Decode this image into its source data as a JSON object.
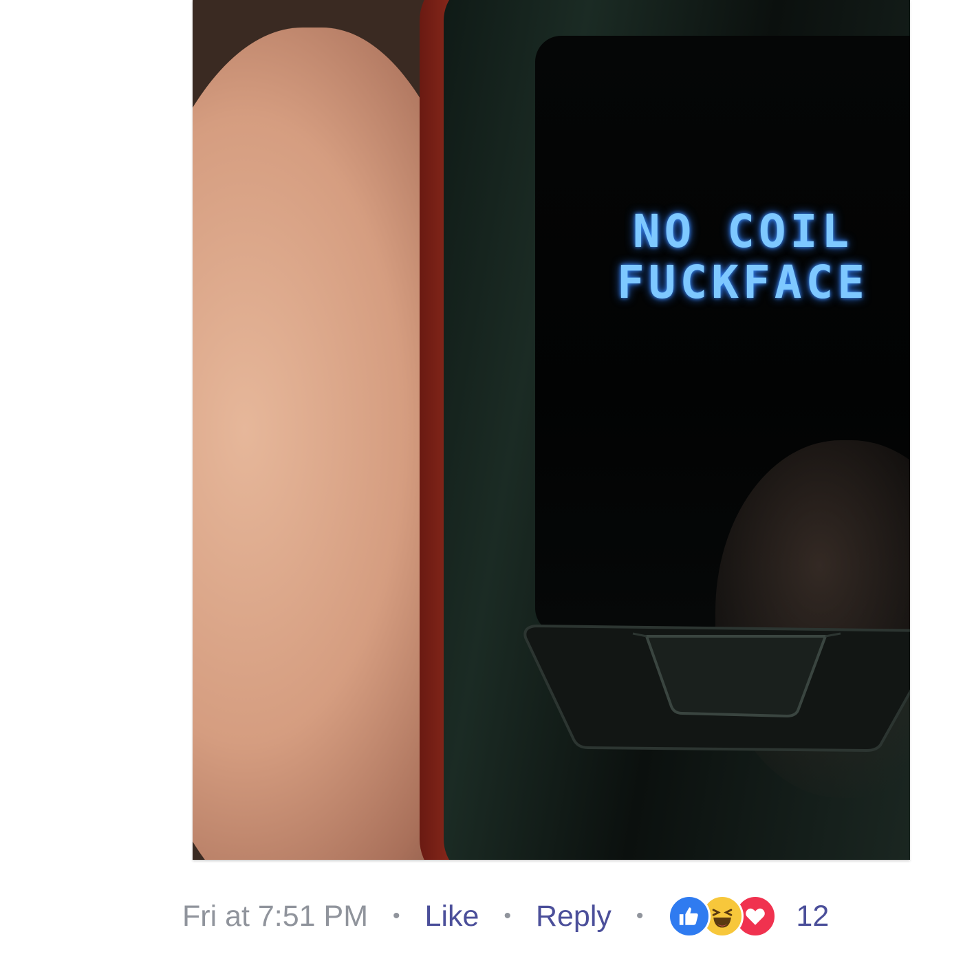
{
  "photo": {
    "screen_text_line1": "NO COIL",
    "screen_text_line2": "FUCKFACE",
    "screen_text_color": "#7ec8ff"
  },
  "comment_footer": {
    "timestamp": "Fri at 7:51 PM",
    "separator": "•",
    "like_label": "Like",
    "reply_label": "Reply",
    "reactions": {
      "icons": [
        "like-icon",
        "haha-icon",
        "love-icon"
      ],
      "count": "12",
      "colors": {
        "like": "#2f7bf0",
        "haha": "#f7c73b",
        "love": "#f0324f"
      }
    },
    "link_color": "#4b4f9a",
    "meta_color": "#90949c"
  }
}
